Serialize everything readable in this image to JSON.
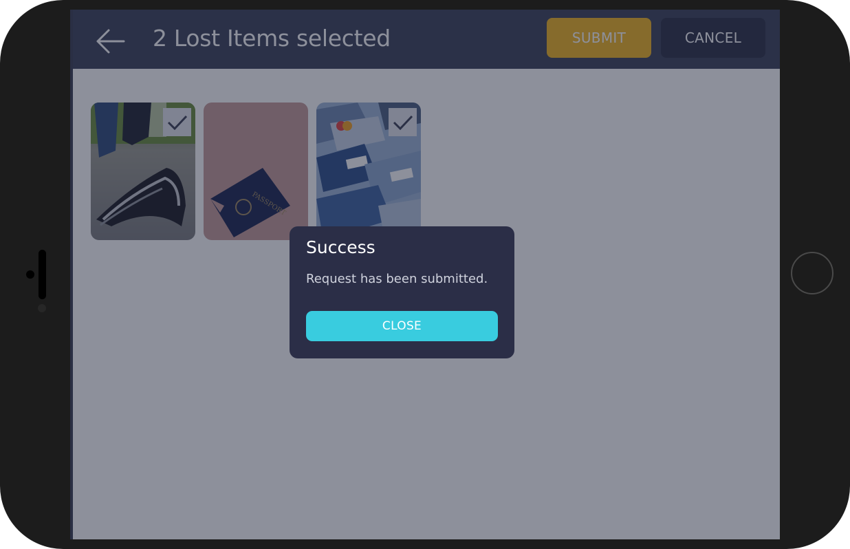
{
  "header": {
    "title": "2 Lost Items selected",
    "back_icon": "arrow-left-icon",
    "submit_label": "SUBMIT",
    "cancel_label": "CANCEL"
  },
  "items": [
    {
      "name": "wallet",
      "selected": true
    },
    {
      "name": "passport",
      "selected": false
    },
    {
      "name": "credit-cards",
      "selected": true
    }
  ],
  "dialog": {
    "title": "Success",
    "message": "Request has been submitted.",
    "close_label": "CLOSE"
  },
  "colors": {
    "appbar": "#3b4159",
    "submit": "#f1b521",
    "cancel": "#2a2e44",
    "dialog": "#2b2e47",
    "close": "#39ccdf"
  }
}
